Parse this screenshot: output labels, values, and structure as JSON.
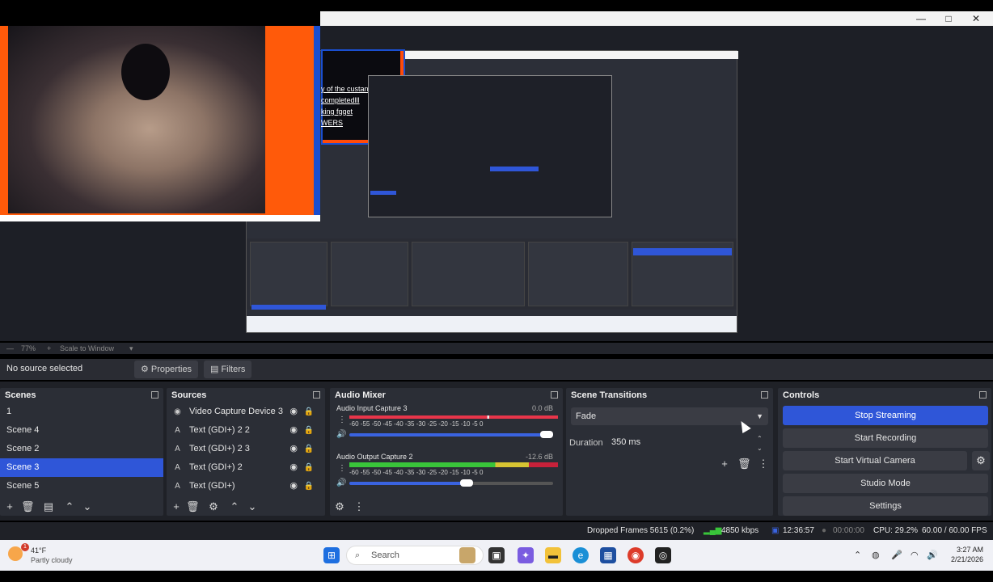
{
  "window": {
    "minimize": "—",
    "maximize": "□",
    "close": "✕"
  },
  "preview": {
    "nested_text_lines": [
      "y of the custanding",
      "completedlll",
      "king fgget",
      "WERS"
    ],
    "zoom_label": "77%",
    "scale_label": "Scale to Window"
  },
  "source_bar": {
    "no_source": "No source selected",
    "properties": "Properties",
    "filters": "Filters"
  },
  "scenes": {
    "title": "Scenes",
    "items": [
      "1",
      "Scene 4",
      "Scene 2",
      "Scene 3",
      "Scene 5"
    ],
    "active_index": 3
  },
  "sources": {
    "title": "Sources",
    "items": [
      {
        "label": "Video Capture Device 3",
        "icon": "camera-icon"
      },
      {
        "label": "Text (GDI+) 2 2",
        "icon": "text-icon"
      },
      {
        "label": "Text (GDI+) 2 3",
        "icon": "text-icon"
      },
      {
        "label": "Text (GDI+) 2",
        "icon": "text-icon"
      },
      {
        "label": "Text (GDI+)",
        "icon": "text-icon"
      }
    ]
  },
  "mixer": {
    "title": "Audio Mixer",
    "channels": [
      {
        "name": "Audio Input Capture 3",
        "db": "0.0 dB",
        "scale": "-60 -55 -50 -45 -40 -35 -30 -25 -20 -15 -10 -5 0",
        "volume": 1.0
      },
      {
        "name": "Audio Output Capture 2",
        "db": "-12.6 dB",
        "scale": "-60 -55 -50 -45 -40 -35 -30 -25 -20 -15 -10 -5 0",
        "volume": 0.58
      }
    ]
  },
  "transitions": {
    "title": "Scene Transitions",
    "selected": "Fade",
    "duration_label": "Duration",
    "duration_value": "350 ms"
  },
  "controls": {
    "title": "Controls",
    "stop_streaming": "Stop Streaming",
    "start_recording": "Start Recording",
    "start_virtual_camera": "Start Virtual Camera",
    "studio_mode": "Studio Mode",
    "settings": "Settings"
  },
  "status": {
    "dropped_frames": "Dropped Frames 5615 (0.2%)",
    "bitrate": "4850 kbps",
    "stream_time": "12:36:57",
    "record_time": "00:00:00",
    "cpu": "CPU: 29.2%",
    "fps": "60.00 / 60.00 FPS"
  },
  "taskbar": {
    "weather_temp": "41°F",
    "weather_desc": "Partly cloudy",
    "search_placeholder": "Search",
    "time": "3:27 AM",
    "date": "2/21/2026",
    "notification_count": "1"
  },
  "colors": {
    "accent": "#2f56d8",
    "webcam_border": "#ff5a0a"
  }
}
